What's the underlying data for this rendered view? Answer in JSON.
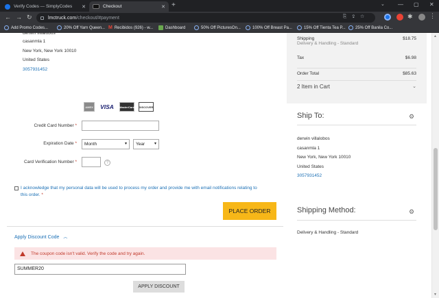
{
  "browser": {
    "tabs": [
      {
        "title": "Verify Codes — SimplyCodes",
        "active": false
      },
      {
        "title": "Checkout",
        "active": true
      }
    ],
    "url_domain": "lmctruck.com",
    "url_path": "/checkout/#payment",
    "bookmarks": [
      "Add Promo Codes...",
      "20% Off Yarn Queen...",
      "Recibidos (926) - w...",
      "Dashboard",
      "50% Off PicturesOn...",
      "100% Off Breast Pa...",
      "15% Off Tienta Tea P...",
      "25% Off Banila Co..."
    ]
  },
  "billing_address": {
    "name_partial": "derwin villalobos",
    "street": "casanmla 1",
    "city_line": "New York, New York 10010",
    "country": "United States",
    "phone": "3057931452"
  },
  "payment": {
    "cards": [
      "AMEX",
      "VISA",
      "MasterCard",
      "DISCOVER"
    ],
    "cc_number_label": "Credit Card Number",
    "expiration_label": "Expiration Date",
    "month_placeholder": "Month",
    "year_placeholder": "Year",
    "cvv_label": "Card Verification Number",
    "help_symbol": "?",
    "required_mark": "*"
  },
  "consent": {
    "text": "I acknowledge that my personal data will be used to process my order and provide me with email notifications relating to this order.",
    "required_mark": "*"
  },
  "place_order_label": "PLACE ORDER",
  "discount": {
    "toggle_label": "Apply Discount Code",
    "error": "The coupon code isn't valid. Verify the code and try again.",
    "code_value": "SUMMER20",
    "apply_label": "APPLY DISCOUNT"
  },
  "summary": {
    "shipping_label": "Shipping",
    "shipping_sub": "Delivery & Handling - Standard",
    "shipping_amount": "$18.75",
    "tax_label": "Tax",
    "tax_amount": "$6.98",
    "total_label": "Order Total",
    "total_amount": "$85.63",
    "items_label": "2 Item in Cart"
  },
  "ship_to": {
    "heading": "Ship To:",
    "name": "derwin villalobos",
    "street": "casanmla 1",
    "city_line": "New York, New York 10010",
    "country": "United States",
    "phone": "3057931452"
  },
  "shipping_method": {
    "heading": "Shipping Method:",
    "value": "Delivery & Handling - Standard"
  },
  "colors": {
    "accent_button": "#f7b718",
    "link": "#1a6fb5",
    "error_bg": "#fbe3e4",
    "error_text": "#c0392b"
  }
}
